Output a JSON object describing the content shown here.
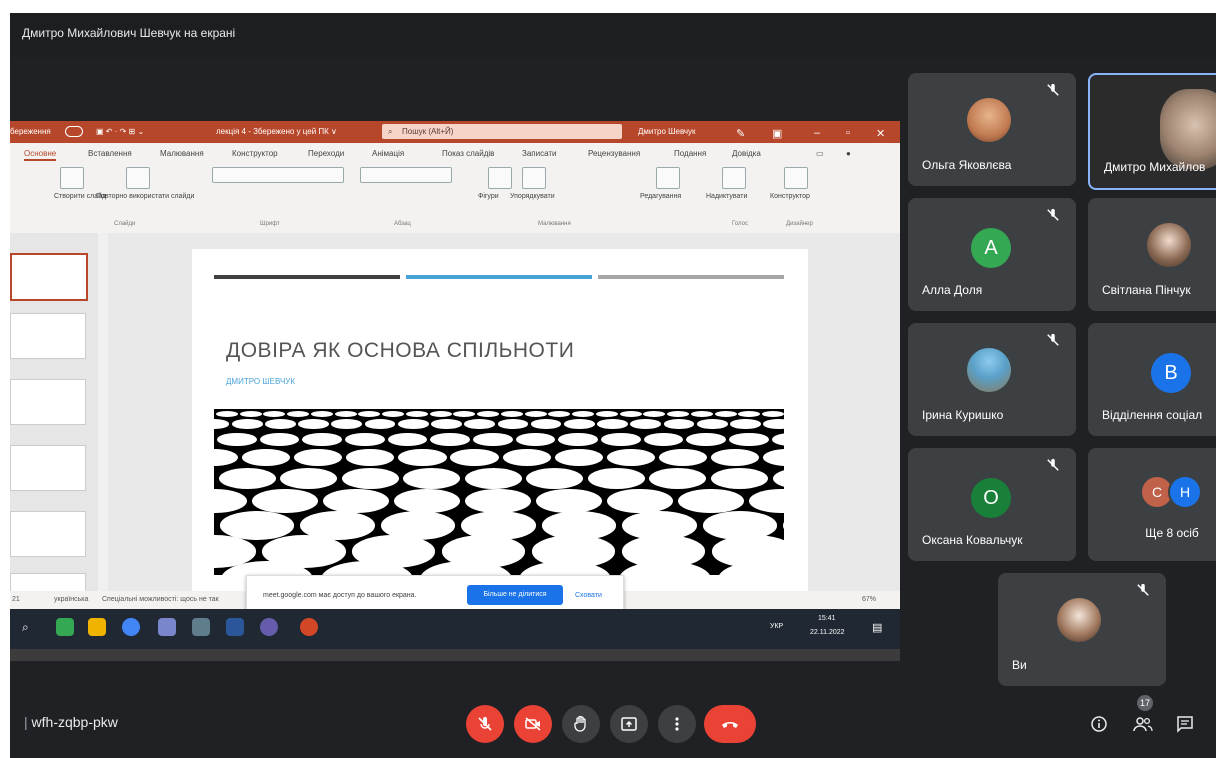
{
  "meeting": {
    "presenter_banner": "Дмитро Михайлович Шевчук на екрані",
    "meeting_code": "wfh-zqbp-pkw",
    "participant_count": "17"
  },
  "powerpoint": {
    "title_left": "береження",
    "doc_name": "лекція 4 - Збережено у цей ПК ∨",
    "search_placeholder": "Пошук (Alt+Й)",
    "user_name": "Дмитро Шевчук",
    "tabs": [
      "Основне",
      "Вставлення",
      "Малювання",
      "Конструктор",
      "Переходи",
      "Анімація",
      "Показ слайдів",
      "Записати",
      "Рецензування",
      "Подання",
      "Довідка"
    ],
    "ribbon_buttons": [
      "Створити слайд",
      "Повторно використати слайди",
      "Фігури",
      "Упорядкувати",
      "Редагування",
      "Надиктувати",
      "Конструктор"
    ],
    "ribbon_groups": [
      "Слайди",
      "Шрифт",
      "Абзац",
      "Малювання",
      "Голос",
      "Дизайнер"
    ],
    "slide": {
      "title": "ДОВІРА ЯК ОСНОВА СПІЛЬНОТИ",
      "subtitle": "ДМИТРО ШЕВЧУК"
    },
    "status": {
      "slide_info": "21",
      "language": "українська",
      "accessibility": "Спеціальні можливості: щось не так",
      "zoom": "67%"
    },
    "sharing_banner": {
      "text": "meet.google.com має доступ до вашого екрана.",
      "stop_button": "Більше не ділитися",
      "hide_button": "Сховати"
    },
    "taskbar": {
      "lang": "УКР",
      "time": "15:41",
      "date": "22.11.2022"
    }
  },
  "participants": [
    {
      "name": "Ольга Яковлєва",
      "muted": true,
      "kind": "photo"
    },
    {
      "name": "Дмитро Михайлов",
      "muted": false,
      "kind": "video"
    },
    {
      "name": "Алла Доля",
      "muted": true,
      "kind": "letter",
      "letter": "A",
      "color": "#34a853"
    },
    {
      "name": "Світлана Пінчук",
      "muted": false,
      "kind": "photo"
    },
    {
      "name": "Ірина Куришко",
      "muted": true,
      "kind": "photo"
    },
    {
      "name": "Відділення соціал",
      "muted": false,
      "kind": "letter",
      "letter": "B",
      "color": "#1a73e8"
    },
    {
      "name": "Оксана Ковальчук",
      "muted": true,
      "kind": "letter",
      "letter": "O",
      "color": "#188038"
    },
    {
      "name": "Ще 8 осіб",
      "kind": "group",
      "letters": [
        "C",
        "H"
      ],
      "colors": [
        "#c0624a",
        "#1a73e8"
      ]
    },
    {
      "name": "Ви",
      "muted": true,
      "kind": "photo"
    }
  ],
  "colors": {
    "meet_bg": "#202124",
    "tile_bg": "#3c4043",
    "danger": "#ea4335",
    "ppt_accent": "#b7472a"
  }
}
